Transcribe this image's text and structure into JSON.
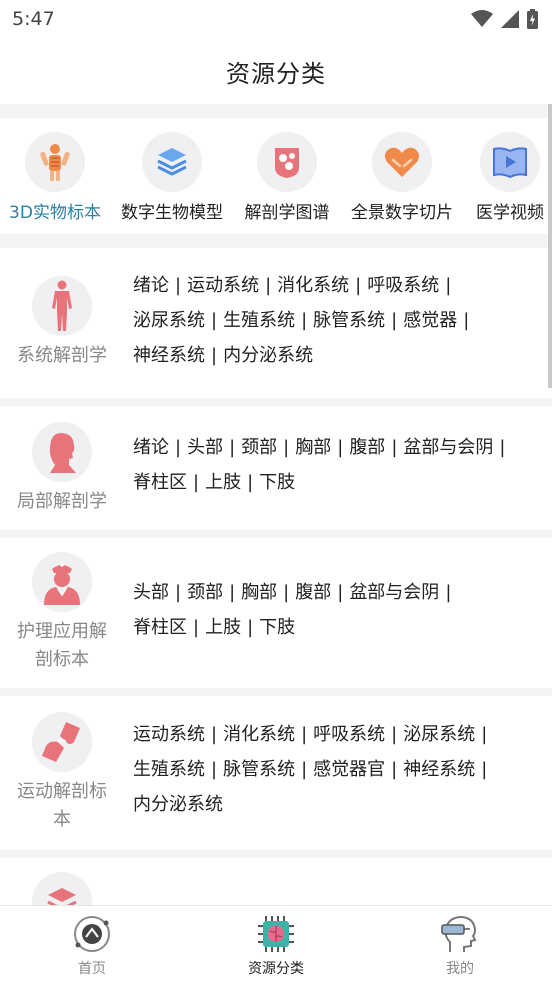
{
  "status_bar": {
    "time": "5:47"
  },
  "header": {
    "title": "资源分类"
  },
  "categories": [
    {
      "label": "3D实物标本",
      "icon": "anatomy-model-icon",
      "active": true
    },
    {
      "label": "数字生物模型",
      "icon": "layers-icon",
      "active": false
    },
    {
      "label": "解剖学图谱",
      "icon": "atlas-icon",
      "active": false
    },
    {
      "label": "全景数字切片",
      "icon": "heart-hands-icon",
      "active": false
    },
    {
      "label": "医学视频",
      "icon": "video-book-icon",
      "active": false
    }
  ],
  "sections": [
    {
      "name": "系统解剖学",
      "icon": "human-body-icon",
      "links": [
        "绪论",
        "运动系统",
        "消化系统",
        "呼吸系统",
        "泌尿系统",
        "生殖系统",
        "脉管系统",
        "感觉器",
        "神经系统",
        "内分泌系统"
      ]
    },
    {
      "name": "局部解剖学",
      "icon": "head-profile-icon",
      "links": [
        "绪论",
        "头部",
        "颈部",
        "胸部",
        "腹部",
        "盆部与会阴",
        "脊柱区",
        "上肢",
        "下肢"
      ]
    },
    {
      "name": "护理应用解剖标本",
      "icon": "nurse-icon",
      "links": [
        "头部",
        "颈部",
        "胸部",
        "腹部",
        "盆部与会阴",
        "脊柱区",
        "上肢",
        "下肢"
      ]
    },
    {
      "name": "运动解剖标本",
      "icon": "joint-icon",
      "links": [
        "运动系统",
        "消化系统",
        "呼吸系统",
        "泌尿系统",
        "生殖系统",
        "脉管系统",
        "感觉器官",
        "神经系统",
        "内分泌系统"
      ]
    }
  ],
  "tab_bar": {
    "tabs": [
      {
        "label": "首页",
        "icon": "home-logo-icon",
        "active": false
      },
      {
        "label": "资源分类",
        "icon": "brain-chip-icon",
        "active": true
      },
      {
        "label": "我的",
        "icon": "vr-head-icon",
        "active": false
      }
    ]
  },
  "colors": {
    "accent": "#2a7fa5",
    "icon_red": "#e8737a",
    "icon_blue": "#4a8fe0",
    "icon_orange": "#f08a4b"
  }
}
